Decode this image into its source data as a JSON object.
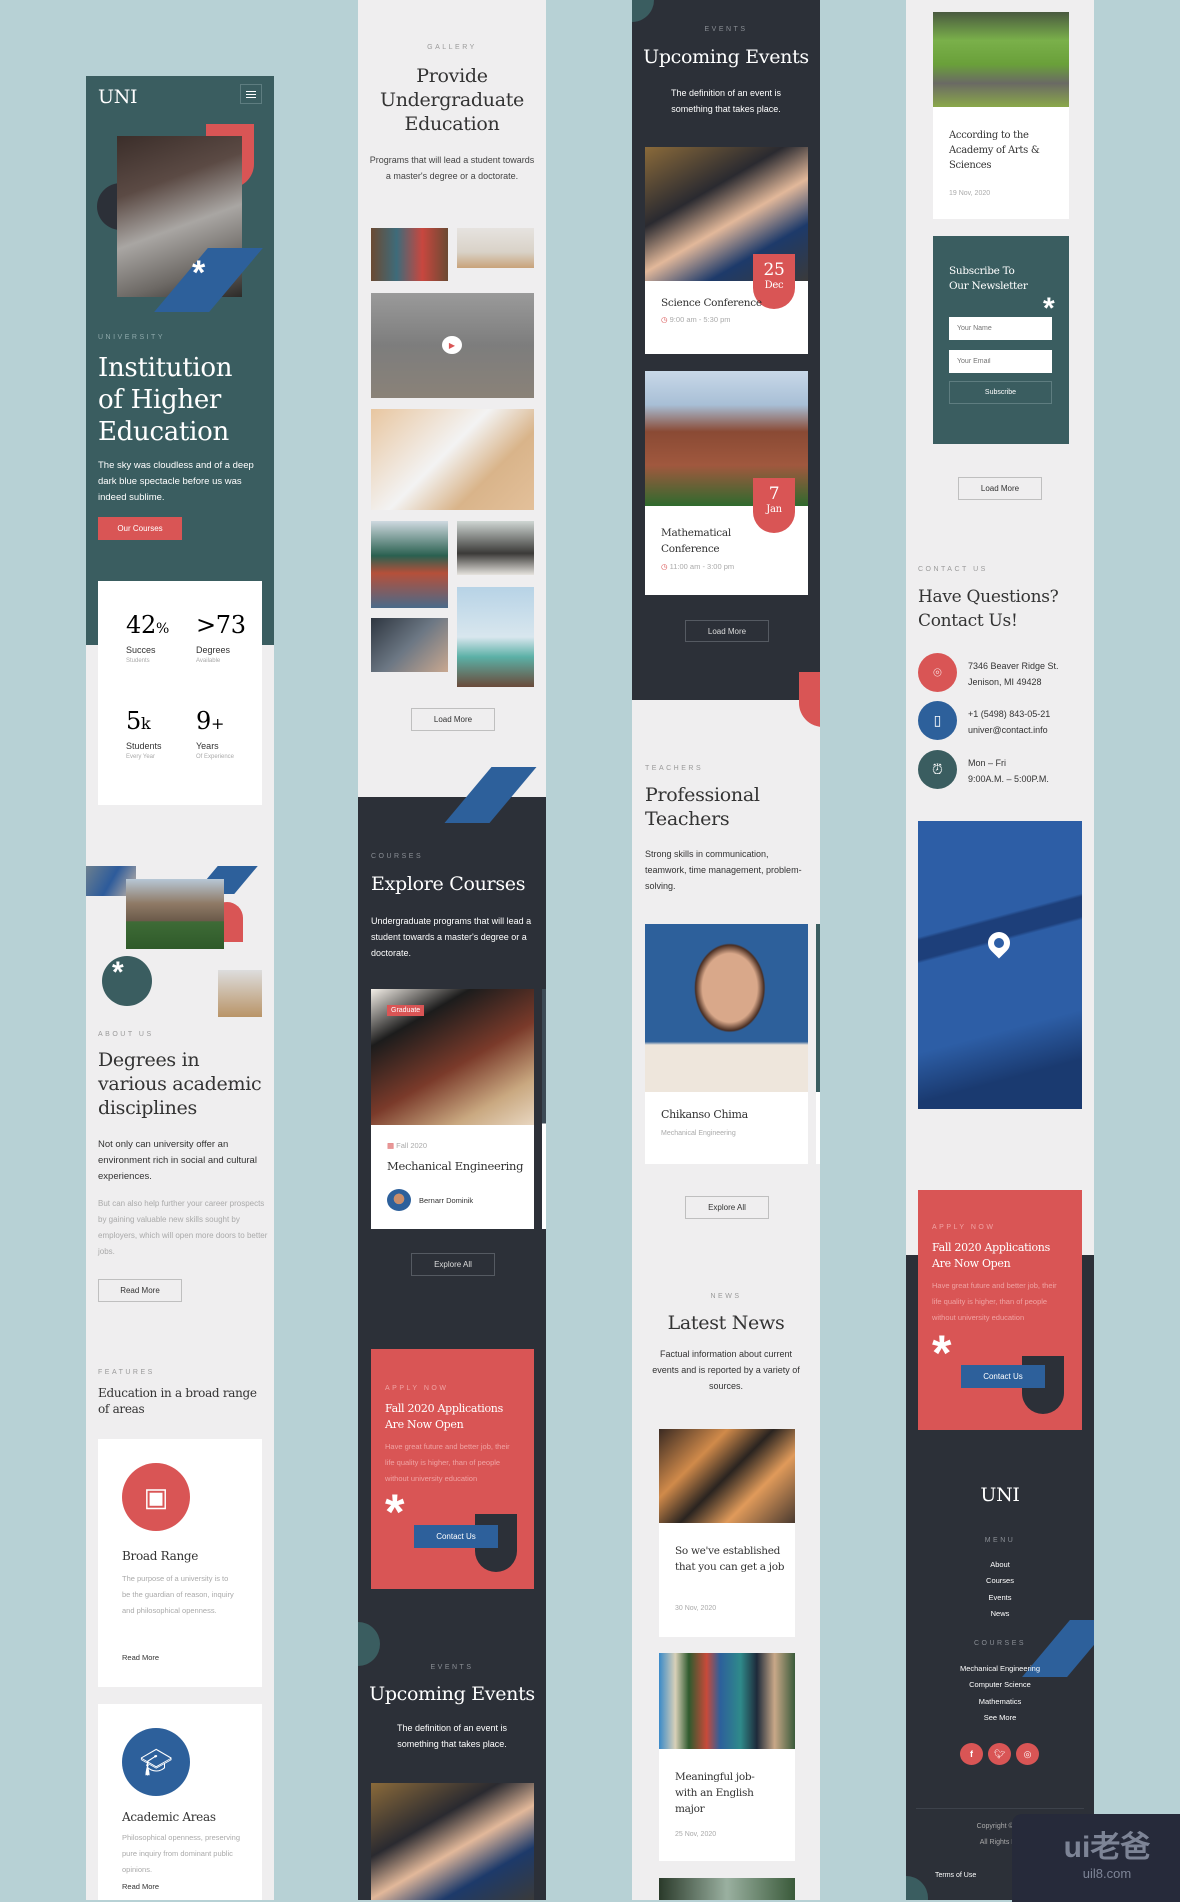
{
  "colors": {
    "teal": "#3a5d60",
    "red": "#d95555",
    "blue": "#2d609b",
    "dark": "#2c3038",
    "light": "#efeeef",
    "background": "#b7d1d5"
  },
  "header": {
    "logo": "UNI",
    "menu_icon": "hamburger-icon"
  },
  "hero": {
    "eyebrow": "UNIVERSITY",
    "title_lines": [
      "Institution",
      "of Higher",
      "Education"
    ],
    "text": "The sky was cloudless and of a deep dark blue spectacle before us was indeed sublime.",
    "button": "Our Courses"
  },
  "stats": [
    {
      "value": "42",
      "unit": "%",
      "label": "Succes",
      "sub": "Students"
    },
    {
      "value": ">73",
      "unit": "",
      "label": "Degrees",
      "sub": "Available"
    },
    {
      "value": "5",
      "unit": "k",
      "label": "Students",
      "sub": "Every Year"
    },
    {
      "value": "9",
      "unit": "+",
      "label": "Years",
      "sub": "Of Experience"
    }
  ],
  "about": {
    "eyebrow": "ABOUT US",
    "title_lines": [
      "Degrees in",
      "various academic",
      "disciplines"
    ],
    "lead": "Not only can university offer an environment rich in social and cultural experiences.",
    "text": "But can also help further your career prospects by gaining valuable new skills sought by employers, which will open more doors to better jobs.",
    "button": "Read More"
  },
  "features": {
    "eyebrow": "FEATURES",
    "title": "Education in a broad range of  areas",
    "items": [
      {
        "icon": "teacher-board-icon",
        "title": "Broad Range",
        "text": "The purpose of a university is to be the guardian of reason, inquiry and philosophical openness.",
        "link": "Read More"
      },
      {
        "icon": "graduation-cap-icon",
        "title": "Academic Areas",
        "text": "Philosophical openness, preserving pure inquiry from dominant public opinions.",
        "link": "Read More"
      }
    ]
  },
  "gallery": {
    "eyebrow": "GALLERY",
    "title_lines": [
      "Provide",
      "Undergraduate",
      "Education"
    ],
    "text": "Programs that will lead a student towards a master's degree or a doctorate.",
    "button": "Load More"
  },
  "courses": {
    "eyebrow": "COURSES",
    "title": "Explore Courses",
    "text": "Undergraduate programs that will lead a student towards a master's degree or a doctorate.",
    "card": {
      "badge": "Graduate",
      "term": "Fall 2020",
      "title": "Mechanical Engineering",
      "teacher": "Bernarr Dominik"
    },
    "button": "Explore All"
  },
  "apply": {
    "eyebrow": "APPLY NOW",
    "title_lines": [
      "Fall 2020 Applications",
      "Are Now Open"
    ],
    "text": "Have great future and better job, their life quality is higher, than of people without university education",
    "button": "Contact Us"
  },
  "events": {
    "eyebrow": "EVENTS",
    "title": "Upcoming Events",
    "text": "The definition of an event is something that takes place.",
    "items": [
      {
        "day": "25",
        "month": "Dec",
        "title": "Science Conference",
        "time": "9:00 am - 5:30 pm"
      },
      {
        "day": "7",
        "month": "Jan",
        "title": "Mathematical Conference",
        "time": "11:00 am - 3:00 pm"
      }
    ],
    "button": "Load More"
  },
  "teachers": {
    "eyebrow": "TEACHERS",
    "title_lines": [
      "Professional",
      "Teachers"
    ],
    "text": "Strong skills in communication, teamwork, time management, problem-solving.",
    "card": {
      "name": "Chikanso Chima",
      "dept": "Mechanical Engineering"
    },
    "button": "Explore All"
  },
  "news": {
    "eyebrow": "NEWS",
    "title": "Latest News",
    "text": "Factual information about current events and is reported by a variety of sources.",
    "items": [
      {
        "title": "So we've established that you can get a job",
        "date": "30 Nov, 2020"
      },
      {
        "title": "Meaningful job- with an English major",
        "date": "25 Nov, 2020"
      },
      {
        "title": "According to the Academy of Arts & Sciences",
        "date": "19 Nov, 2020"
      }
    ],
    "button": "Load More"
  },
  "newsletter": {
    "title_lines": [
      "Subscribe To",
      "Our Newsletter"
    ],
    "name_placeholder": "Your Name",
    "email_placeholder": "Your Email",
    "button": "Subscribe"
  },
  "contact": {
    "eyebrow": "CONTACT US",
    "title_lines": [
      "Have Questions?",
      "Contact Us!"
    ],
    "items": [
      {
        "icon": "location-pin-icon",
        "lines": [
          "7346 Beaver Ridge St.",
          "Jenison, MI 49428"
        ]
      },
      {
        "icon": "phone-mail-icon",
        "lines": [
          "+1 (5498) 843-05-21",
          "univer@contact.info"
        ]
      },
      {
        "icon": "alarm-clock-icon",
        "lines": [
          "Mon – Fri",
          "9:00A.M. – 5:00P.M."
        ]
      }
    ]
  },
  "footer": {
    "logo": "UNI",
    "menu_heading": "MENU",
    "menu": [
      "About",
      "Courses",
      "Events",
      "News"
    ],
    "courses_heading": "COURSES",
    "courses": [
      "Mechanical Engineering",
      "Computer Science",
      "Mathematics",
      "See More"
    ],
    "social": [
      "facebook-icon",
      "twitter-icon",
      "instagram-icon"
    ],
    "copyright": "Copyright © 20",
    "rights": "All Rights Re",
    "terms": "Terms of Use"
  },
  "watermark": {
    "logo": "ui老爸",
    "url": "uil8.com"
  }
}
